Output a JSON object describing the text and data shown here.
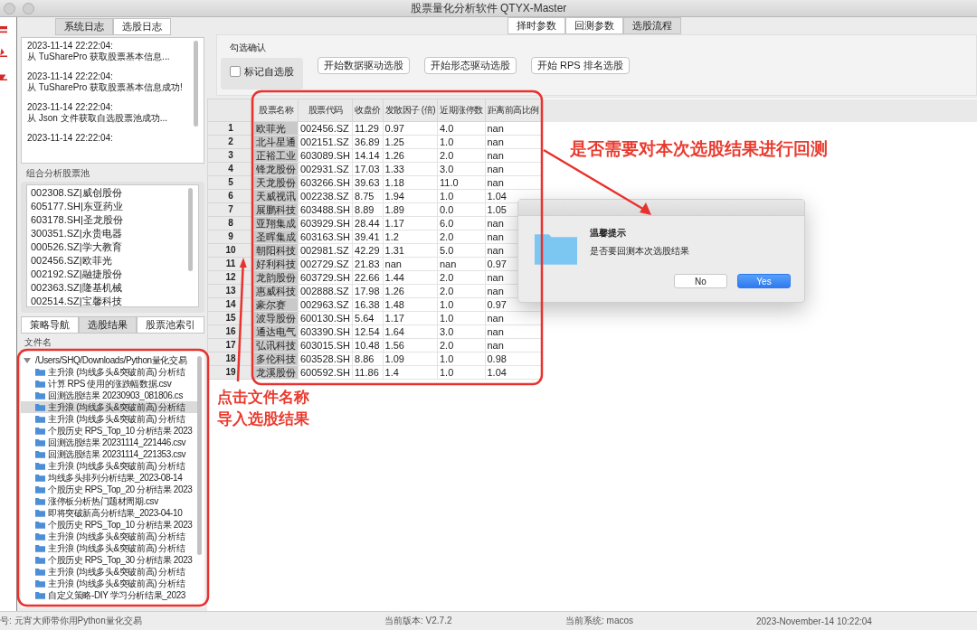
{
  "window": {
    "title": "股票量化分析软件 QTYX-Master"
  },
  "log_tabs": [
    {
      "label": "系统日志",
      "selected": true
    },
    {
      "label": "选股日志",
      "selected": false
    }
  ],
  "log": [
    {
      "time": "2023-11-14 22:22:04:",
      "message": "从 TuSharePro 获取股票基本信息..."
    },
    {
      "time": "2023-11-14 22:22:04:",
      "message": "从 TuSharePro 获取股票基本信息成功!"
    },
    {
      "time": "2023-11-14 22:22:04:",
      "message": "从 Json 文件获取自选股票池成功..."
    },
    {
      "time": "2023-11-14 22:22:04:"
    }
  ],
  "pool": {
    "label": "组合分析股票池",
    "items": [
      "002308.SZ|威创股份",
      "605177.SH|东亚药业",
      "603178.SH|圣龙股份",
      "300351.SZ|永贵电器",
      "000526.SZ|学大教育",
      "002456.SZ|欧菲光",
      "002192.SZ|融捷股份",
      "002363.SZ|隆基机械",
      "002514.SZ|宝馨科技"
    ]
  },
  "nav_tabs": [
    {
      "label": "策略导航",
      "selected": false
    },
    {
      "label": "选股结果",
      "selected": true
    },
    {
      "label": "股票池索引",
      "selected": false
    }
  ],
  "file_tree": {
    "header": "文件名",
    "root": {
      "label": "/Users/SHQ/Downloads/Python量化交易",
      "expanded": true,
      "children": [
        {
          "label": "主升浪 (均线多头&突破前高) 分析结",
          "selected": false
        },
        {
          "label": "计算 RPS 使用的涨跌幅数据.csv",
          "selected": false
        },
        {
          "label": "回测选股结果 20230903_081806.cs",
          "selected": false
        },
        {
          "label": "主升浪 (均线多头&突破前高) 分析结",
          "selected": true
        },
        {
          "label": "主升浪 (均线多头&突破前高) 分析结",
          "selected": false
        },
        {
          "label": "个股历史 RPS_Top_10 分析结果 2023",
          "selected": false
        },
        {
          "label": "回测选股结果 20231114_221446.csv",
          "selected": false
        },
        {
          "label": "回测选股结果 20231114_221353.csv",
          "selected": false
        },
        {
          "label": "主升浪 (均线多头&突破前高) 分析结",
          "selected": false
        },
        {
          "label": "均线多头排列分析结果_2023-08-14",
          "selected": false
        },
        {
          "label": "个股历史 RPS_Top_20 分析结果 2023",
          "selected": false
        },
        {
          "label": "涨停板分析热门题材周期.csv",
          "selected": false
        },
        {
          "label": "即将突破新高分析结果_2023-04-10",
          "selected": false
        },
        {
          "label": "个股历史 RPS_Top_10 分析结果 2023",
          "selected": false
        },
        {
          "label": "主升浪 (均线多头&突破前高) 分析结",
          "selected": false
        },
        {
          "label": "主升浪 (均线多头&突破前高) 分析结",
          "selected": false
        },
        {
          "label": "个股历史 RPS_Top_30 分析结果 2023",
          "selected": false
        },
        {
          "label": "主升浪 (均线多头&突破前高) 分析结",
          "selected": false
        },
        {
          "label": "主升浪 (均线多头&突破前高) 分析结",
          "selected": false
        },
        {
          "label": "自定义策略-DIY 学习分析结果_2023",
          "selected": false
        }
      ]
    }
  },
  "param_tabs": [
    {
      "label": "择时参数",
      "selected": false
    },
    {
      "label": "回测参数",
      "selected": false
    },
    {
      "label": "选股流程",
      "selected": true
    }
  ],
  "selection": {
    "group_label": "勾选确认",
    "checkbox": {
      "label": "标记自选股",
      "checked": false
    },
    "buttons": [
      "开始数据驱动选股",
      "开始形态驱动选股",
      "开始 RPS 排名选股"
    ]
  },
  "table": {
    "columns": [
      "",
      "股票名称",
      "股票代码",
      "收盘价",
      "发散因子 (倍)",
      "近期涨停数",
      "距离前高比例"
    ],
    "rows": [
      [
        "1",
        "欧菲光",
        "002456.SZ",
        "11.29",
        "0.97",
        "4.0",
        "nan"
      ],
      [
        "2",
        "北斗星通",
        "002151.SZ",
        "36.89",
        "1.25",
        "1.0",
        "nan"
      ],
      [
        "3",
        "正裕工业",
        "603089.SH",
        "14.14",
        "1.26",
        "2.0",
        "nan"
      ],
      [
        "4",
        "锋龙股份",
        "002931.SZ",
        "17.03",
        "1.33",
        "3.0",
        "nan"
      ],
      [
        "5",
        "天龙股份",
        "603266.SH",
        "39.63",
        "1.18",
        "11.0",
        "nan"
      ],
      [
        "6",
        "天威视讯",
        "002238.SZ",
        "8.75",
        "1.94",
        "1.0",
        "1.04"
      ],
      [
        "7",
        "展鹏科技",
        "603488.SH",
        "8.89",
        "1.89",
        "0.0",
        "1.05"
      ],
      [
        "8",
        "亚翔集成",
        "603929.SH",
        "28.44",
        "1.17",
        "6.0",
        "nan"
      ],
      [
        "9",
        "圣晖集成",
        "603163.SH",
        "39.41",
        "1.2",
        "2.0",
        "nan"
      ],
      [
        "10",
        "朝阳科技",
        "002981.SZ",
        "42.29",
        "1.31",
        "5.0",
        "nan"
      ],
      [
        "11",
        "好利科技",
        "002729.SZ",
        "21.83",
        "nan",
        "nan",
        "0.97"
      ],
      [
        "12",
        "龙韵股份",
        "603729.SH",
        "22.66",
        "1.44",
        "2.0",
        "nan"
      ],
      [
        "13",
        "惠威科技",
        "002888.SZ",
        "17.98",
        "1.26",
        "2.0",
        "nan"
      ],
      [
        "14",
        "豪尔赛",
        "002963.SZ",
        "16.38",
        "1.48",
        "1.0",
        "0.97"
      ],
      [
        "15",
        "波导股份",
        "600130.SH",
        "5.64",
        "1.17",
        "1.0",
        "nan"
      ],
      [
        "16",
        "通达电气",
        "603390.SH",
        "12.54",
        "1.64",
        "3.0",
        "nan"
      ],
      [
        "17",
        "弘讯科技",
        "603015.SH",
        "10.48",
        "1.56",
        "2.0",
        "nan"
      ],
      [
        "18",
        "多伦科技",
        "603528.SH",
        "8.86",
        "1.09",
        "1.0",
        "0.98"
      ],
      [
        "19",
        "龙溪股份",
        "600592.SH",
        "11.86",
        "1.4",
        "1.0",
        "1.04"
      ]
    ]
  },
  "dialog": {
    "title": "温馨提示",
    "message": "是否要回测本次选股结果",
    "buttons": [
      {
        "label": "No",
        "default": false
      },
      {
        "label": "Yes",
        "default": true
      }
    ]
  },
  "annotations": [
    {
      "kind": "note",
      "text": "是否需要对本次选股结果进行回测"
    },
    {
      "kind": "note",
      "text": "点击文件名称"
    },
    {
      "kind": "note",
      "text": "导入选股结果"
    }
  ],
  "status_bar": [
    "号: 元宵大师带你用Python量化交易",
    "当前版本: V2.7.2",
    "当前系统: macos",
    "2023-November-14 10:22:04"
  ]
}
